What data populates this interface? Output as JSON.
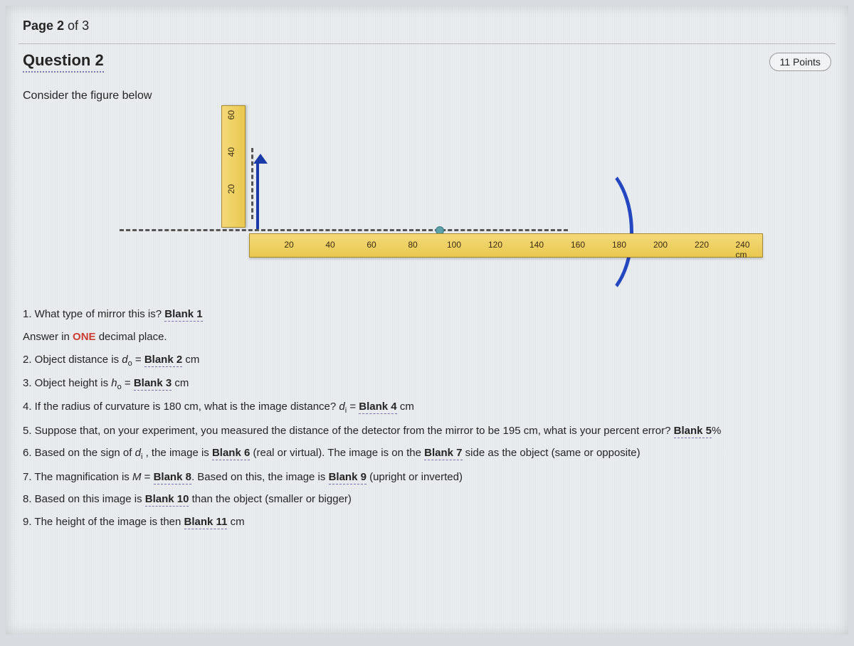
{
  "page": {
    "current": "2",
    "total": "3",
    "prefix": "Page ",
    "of": " of "
  },
  "question": {
    "label": "Question 2",
    "points": "11 Points"
  },
  "instruction": "Consider the figure below",
  "ruler_h": {
    "labels": [
      "20",
      "40",
      "60",
      "80",
      "100",
      "120",
      "140",
      "160",
      "180",
      "200",
      "220",
      "240 cm"
    ]
  },
  "ruler_v": {
    "labels": [
      "20",
      "40",
      "60"
    ]
  },
  "one_label": "ONE",
  "q1": {
    "a": "1. What type of mirror this is? ",
    "blank": "Blank 1"
  },
  "q1b": {
    "a": "Answer in ",
    "b": " decimal place."
  },
  "q2": {
    "a": "2. Object distance is ",
    "var": "d",
    "sub": "o",
    "eq": "  =  ",
    "blank": "Blank 2",
    "unit": " cm"
  },
  "q3": {
    "a": "3. Object height is ",
    "var": "h",
    "sub": "o",
    "eq": "  =  ",
    "blank": "Blank 3",
    "unit": " cm"
  },
  "q4": {
    "a": "4. If the radius of curvature is 180 cm, what is the image distance? ",
    "var": "d",
    "sub": "i",
    "eq": "  =  ",
    "blank": "Blank 4",
    "unit": " cm"
  },
  "q5": {
    "a": "5. Suppose that, on your experiment, you measured the distance of the detector from the mirror to be 195 cm, what is your percent error? ",
    "blank": "Blank 5",
    "unit": "%"
  },
  "q6": {
    "a": "6. Based on the sign of ",
    "var": "d",
    "sub": "i",
    "b": " , the image is ",
    "blank1": "Blank 6",
    "c": " (real or virtual). The image is on the ",
    "blank2": "Blank 7",
    "d": " side as the object (same or opposite)"
  },
  "q7": {
    "a": "7. The magnification is ",
    "var": "M",
    "eq": " = ",
    "blank1": "Blank 8",
    "b": ". Based on this, the image is ",
    "blank2": "Blank 9",
    "c": " (upright or inverted)"
  },
  "q8": {
    "a": "8. Based on this image is ",
    "blank": "Blank 10",
    "b": " than the object (smaller or bigger)"
  },
  "q9": {
    "a": "9. The height of the image is then ",
    "blank": "Blank 11",
    "b": " cm"
  }
}
